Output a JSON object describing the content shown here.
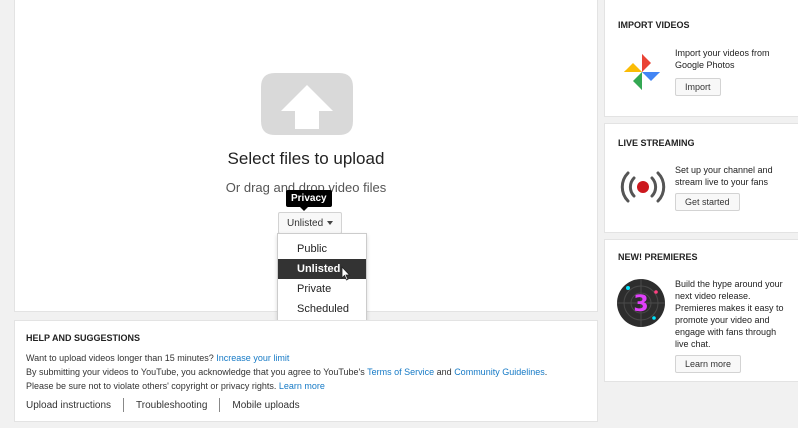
{
  "upload": {
    "title": "Select files to upload",
    "subtitle": "Or drag and drop video files",
    "tooltip": "Privacy",
    "privacy_value": "Unlisted",
    "privacy_options": [
      "Public",
      "Unlisted",
      "Private",
      "Scheduled"
    ],
    "selected_option": "Unlisted"
  },
  "help": {
    "title": "HELP AND SUGGESTIONS",
    "line1_text": "Want to upload videos longer than 15 minutes? ",
    "line1_link": "Increase your limit",
    "line2_text": "By submitting your videos to YouTube, you acknowledge that you agree to YouTube's ",
    "line2_tos": "Terms of Service",
    "line2_and": " and ",
    "line2_guidelines": "Community Guidelines",
    "line2_end": ".",
    "line3_text": "Please be sure not to violate others' copyright or privacy rights. ",
    "line3_link": "Learn more",
    "links": [
      "Upload instructions",
      "Troubleshooting",
      "Mobile uploads"
    ]
  },
  "import_videos": {
    "title": "IMPORT VIDEOS",
    "text": "Import your videos from Google Photos",
    "button": "Import",
    "icon": "google-photos-icon"
  },
  "live_streaming": {
    "title": "LIVE STREAMING",
    "text": "Set up your channel and stream live to your fans",
    "button": "Get started",
    "icon": "live-broadcast-icon"
  },
  "premieres": {
    "title": "NEW! PREMIERES",
    "text": "Build the hype around your next video release. Premieres makes it easy to promote your video and engage with fans through live chat.",
    "button": "Learn more",
    "icon": "premiere-countdown-icon"
  },
  "colors": {
    "link": "#167ac6",
    "menu_selected_bg": "#333333",
    "live_red": "#cc181e"
  }
}
